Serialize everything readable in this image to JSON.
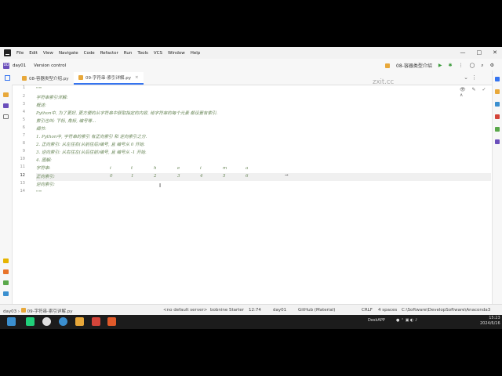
{
  "menu": {
    "items": [
      "File",
      "Edit",
      "View",
      "Navigate",
      "Code",
      "Refactor",
      "Run",
      "Tools",
      "VCS",
      "Window",
      "Help"
    ],
    "window_controls": [
      "—",
      "□",
      "✕"
    ]
  },
  "toolbar": {
    "project_badge": "DD",
    "project_name": "day01",
    "version_control": "Version control",
    "run_config": "08-容器类型介绍",
    "icons": [
      "run-icon",
      "debug-icon",
      "more-icon",
      "user-icon",
      "search-icon",
      "settings-icon"
    ]
  },
  "tabs": [
    {
      "label": "08-容器类型介绍.py",
      "active": false
    },
    {
      "label": "09-字符串-索引详解.py",
      "active": true
    }
  ],
  "watermark": "zxit.cc",
  "editor": {
    "header_icons": "👁 ✎ ✓ ∧",
    "lines": [
      {
        "n": "1",
        "text": "\"\"\""
      },
      {
        "n": "2",
        "text": "字符串索引详解:"
      },
      {
        "n": "3",
        "text": "    概述:"
      },
      {
        "n": "4",
        "text": "        Python中, 为了更好, 更方便的从字符串中获取指定的内容, 给字符串的每个元素 都设置有索引."
      },
      {
        "n": "5",
        "text": "        索引也叫: 下标, 角标, 编号等..."
      },
      {
        "n": "6",
        "text": "    细节:"
      },
      {
        "n": "7",
        "text": "        1. Python中, 字符串的索引 有正向索引 和 逆向索引之分."
      },
      {
        "n": "8",
        "text": "        2. 正向索引: 从左往右(从前往后)编号, 且 编号从 0 开始."
      },
      {
        "n": "9",
        "text": "        3. 逆向索引: 从右往左(从后往前)编号, 且 编号从 -1 开始."
      },
      {
        "n": "10",
        "text": "        4. 图解:"
      },
      {
        "n": "11",
        "text": "            字符串:"
      },
      {
        "n": "12",
        "text": "            正向索引:"
      },
      {
        "n": "13",
        "text": "            逆向索引:"
      },
      {
        "n": "14",
        "text": "\"\"\""
      }
    ],
    "chars": [
      "i",
      "t",
      "h",
      "e",
      "i",
      "m",
      "a"
    ],
    "forward_indexes": [
      "0",
      "1",
      "2",
      "3",
      "4",
      "5",
      "6"
    ],
    "arrow": "→",
    "cursor": "I"
  },
  "status": {
    "breadcrumb_project": "day03",
    "breadcrumb_file": "09-字符串-索引详解.py",
    "server": "<no default server>",
    "starter": "bobnine Starter",
    "position": "12:74",
    "module": "day01",
    "theme": "GitHub (Material)",
    "line_ending": "CRLF",
    "indent": "4 spaces",
    "interpreter": "C:\\Software\\DevelopSoftware\\Anaconda3"
  },
  "taskbar": {
    "tray_app": "DeskAPP",
    "time": "15:23",
    "date": "2024/6/16"
  }
}
